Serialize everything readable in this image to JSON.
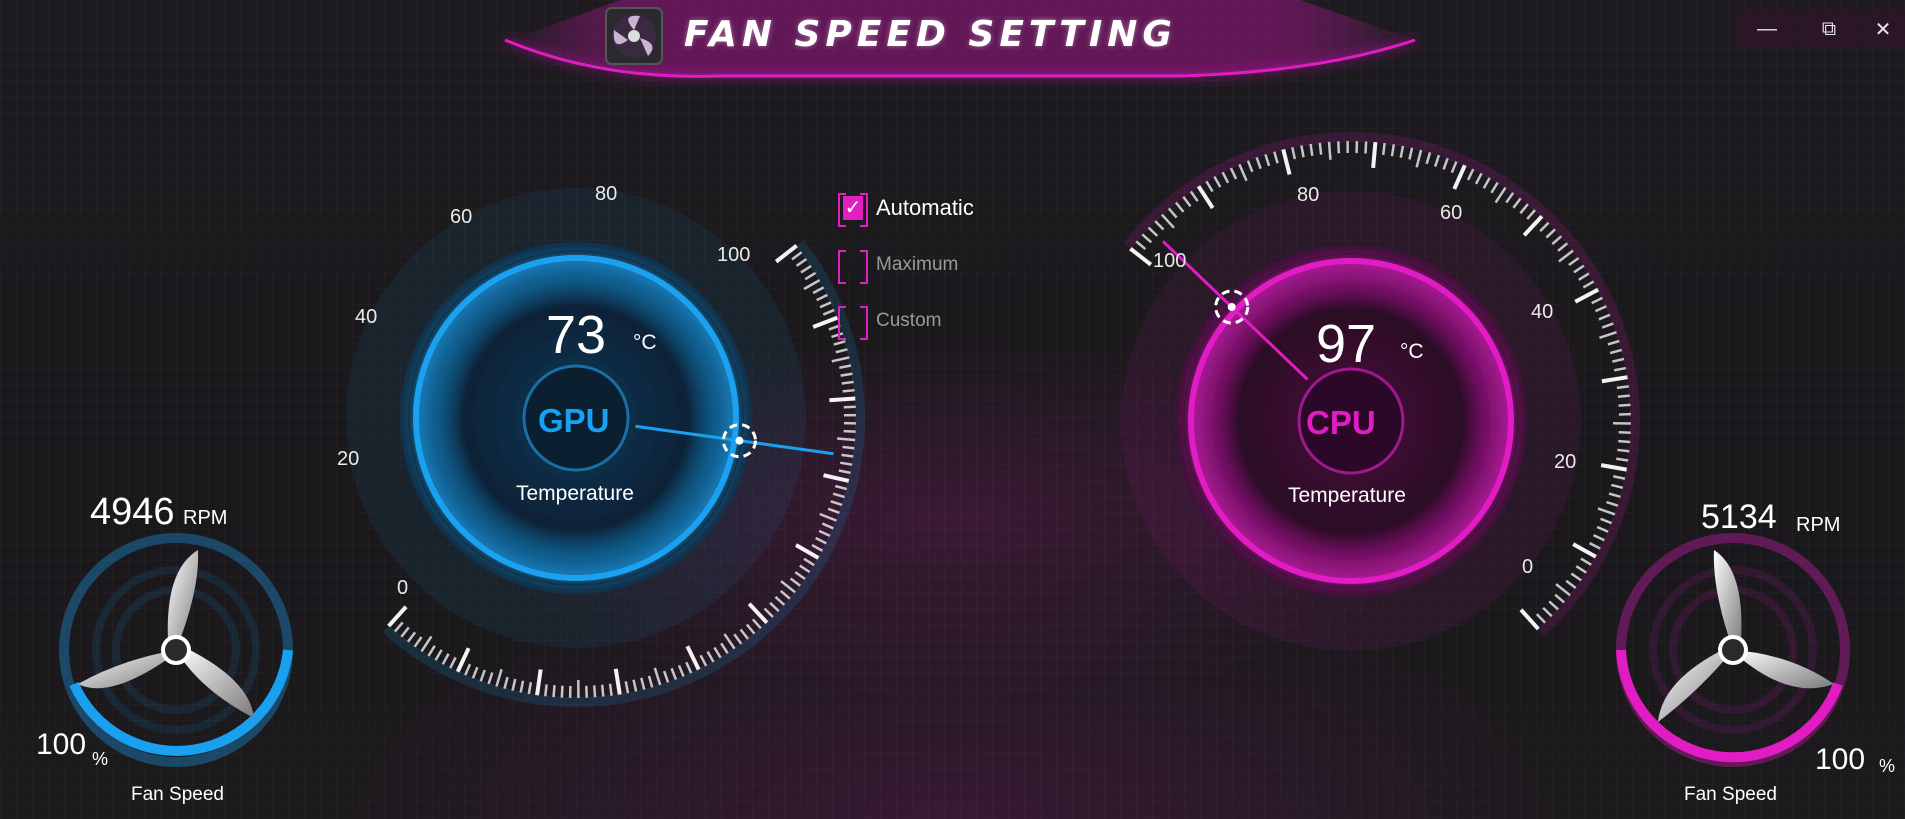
{
  "window": {
    "title": "FAN SPEED SETTING",
    "minimize_label": "—",
    "restore_label": "⧉",
    "close_label": "✕"
  },
  "gpu": {
    "chip_label": "GPU",
    "temperature": "73",
    "temp_unit": "°C",
    "temperature_label": "Temperature",
    "gauge_ticks": [
      "0",
      "20",
      "40",
      "60",
      "80",
      "100"
    ],
    "rpm": "4946",
    "rpm_unit": "RPM",
    "fan_percent": "100",
    "percent_unit": "%",
    "fan_speed_label": "Fan Speed",
    "accent": "#1aa0f0"
  },
  "cpu": {
    "chip_label": "CPU",
    "temperature": "97",
    "temp_unit": "°C",
    "temperature_label": "Temperature",
    "gauge_ticks": [
      "0",
      "20",
      "40",
      "60",
      "80",
      "100"
    ],
    "rpm": "5134",
    "rpm_unit": "RPM",
    "fan_percent": "100",
    "percent_unit": "%",
    "fan_speed_label": "Fan Speed",
    "accent": "#e21cc4"
  },
  "mode": {
    "options": [
      {
        "label": "Automatic",
        "checked": true
      },
      {
        "label": "Maximum",
        "checked": false
      },
      {
        "label": "Custom",
        "checked": false
      }
    ]
  },
  "icons": {
    "app": "fan-logo-icon",
    "check": "checkmark-icon"
  }
}
